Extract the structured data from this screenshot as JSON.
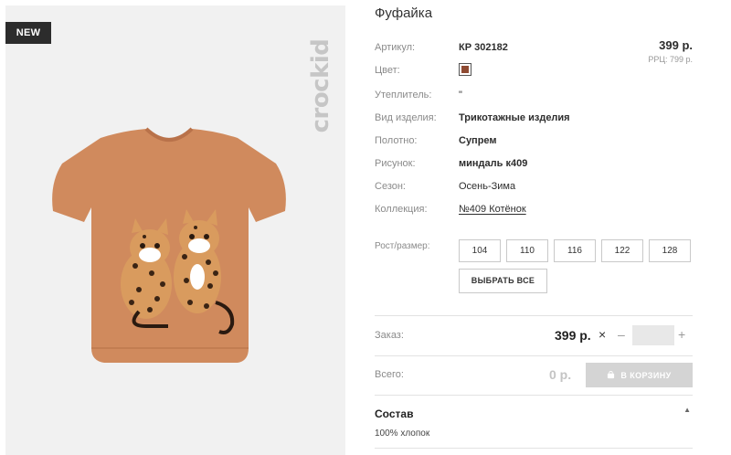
{
  "badge": "NEW",
  "brand": "crockid",
  "product": {
    "title": "Фуфайка",
    "price": "399 р.",
    "rrp": "РРЦ: 799 р.",
    "attributes": [
      {
        "label": "Артикул:",
        "value": "КР 302182"
      },
      {
        "label": "Цвет:",
        "value": ""
      },
      {
        "label": "Утеплитель:",
        "value": "\""
      },
      {
        "label": "Вид изделия:",
        "value": "Трикотажные изделия"
      },
      {
        "label": "Полотно:",
        "value": "Супрем"
      },
      {
        "label": "Рисунок:",
        "value": "миндаль к409"
      },
      {
        "label": "Сезон:",
        "value": "Осень-Зима"
      },
      {
        "label": "Коллекция:",
        "value": "№409 Котёнок"
      }
    ],
    "swatch_color": "#8e4a32"
  },
  "sizes": {
    "label": "Рост/размер:",
    "options": [
      "104",
      "110",
      "116",
      "122",
      "128"
    ],
    "select_all": "ВЫБРАТЬ ВСЕ"
  },
  "order": {
    "label": "Заказ:",
    "price": "399 р.",
    "times": "×",
    "minus": "–",
    "plus": "+",
    "quantity": ""
  },
  "total": {
    "label": "Всего:",
    "value": "0 р.",
    "cart_button": "В КОРЗИНУ"
  },
  "composition": {
    "title": "Состав",
    "toggle": "▲",
    "text": "100% хлопок"
  }
}
